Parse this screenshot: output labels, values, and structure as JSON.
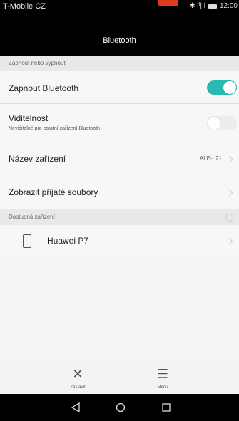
{
  "status_bar": {
    "carrier": "T-Mobile CZ",
    "icons": "✱ ᵗˡ|ıl",
    "time": "12:00"
  },
  "title_bar": {
    "title": "Bluetooth"
  },
  "section_toggle": {
    "header": "Zapnout nebo vypnout"
  },
  "rows": {
    "bluetooth": {
      "label": "Zapnout Bluetooth",
      "state": "on"
    },
    "visibility": {
      "label": "Viditelnost",
      "sub": "Neviditelné pro ostatní zařízení Bluetooth",
      "state": "off"
    },
    "device_name": {
      "label": "Název zařízení",
      "value": "ALE-L21"
    },
    "received_files": {
      "label": "Zobrazit přijaté soubory"
    }
  },
  "section_available": {
    "header": "Dostupná zařízení"
  },
  "devices": [
    {
      "name": "Huawei P7",
      "icon": "phone-icon"
    }
  ],
  "bottom_bar": {
    "stop_label": "Zastavit",
    "menu_label": "Menu"
  },
  "colors": {
    "accent": "#29b9b0",
    "marker": "#e23b1c"
  }
}
